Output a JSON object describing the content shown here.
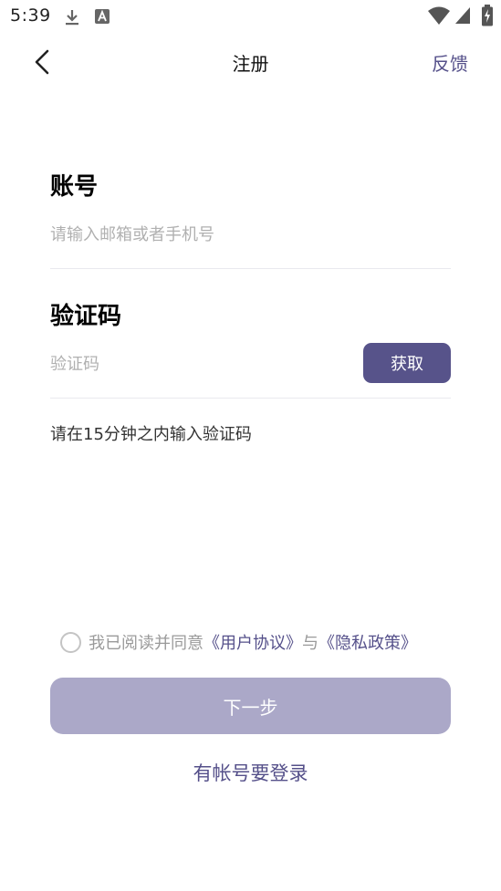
{
  "status_bar": {
    "time": "5:39",
    "icons": [
      "download-icon",
      "text-a-icon",
      "wifi-icon",
      "cellular-signal-icon",
      "battery-charging-icon"
    ]
  },
  "nav": {
    "back_icon": "chevron-left-icon",
    "title": "注册",
    "feedback_label": "反馈"
  },
  "account": {
    "label": "账号",
    "value": "",
    "placeholder": "请输入邮箱或者手机号"
  },
  "verification": {
    "label": "验证码",
    "value": "",
    "placeholder": "验证码",
    "get_code_label": "获取",
    "hint": "请在15分钟之内输入验证码"
  },
  "agreement": {
    "checked": false,
    "prefix": "我已阅读并同意",
    "user_agreement": "《用户协议》",
    "conjunction": "与",
    "privacy_policy": "《隐私政策》"
  },
  "actions": {
    "next_label": "下一步",
    "login_label": "有帐号要登录"
  },
  "colors": {
    "accent": "#57538a",
    "accent_disabled": "#aba8c8",
    "link": "#55508a",
    "placeholder": "#b0b0b0",
    "divider": "#e9e9ee"
  }
}
